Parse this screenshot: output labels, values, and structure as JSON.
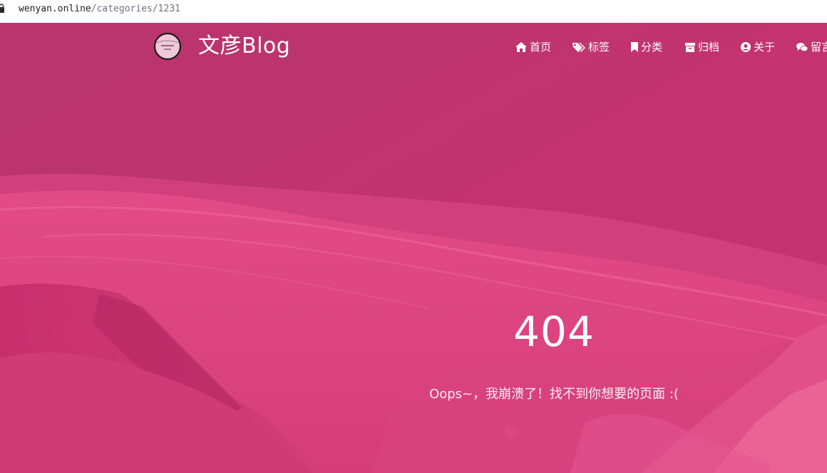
{
  "browser": {
    "url_host": "wenyan.online",
    "url_path": "/categories/1231"
  },
  "header": {
    "brand": "文彦Blog",
    "logo_icon": "circle-logo-icon",
    "nav": [
      {
        "label": "首页",
        "icon": "home-icon"
      },
      {
        "label": "标签",
        "icon": "tags-icon"
      },
      {
        "label": "分类",
        "icon": "bookmark-icon"
      },
      {
        "label": "归档",
        "icon": "archive-icon"
      },
      {
        "label": "关于",
        "icon": "user-circle-icon"
      },
      {
        "label": "留言",
        "icon": "comments-icon"
      }
    ]
  },
  "error": {
    "code": "404",
    "message": "Oops~，我崩溃了！找不到你想要的页面 :("
  },
  "colors": {
    "overlay": "#c2336f",
    "text": "#ffffff",
    "heart": "#e0467f"
  }
}
